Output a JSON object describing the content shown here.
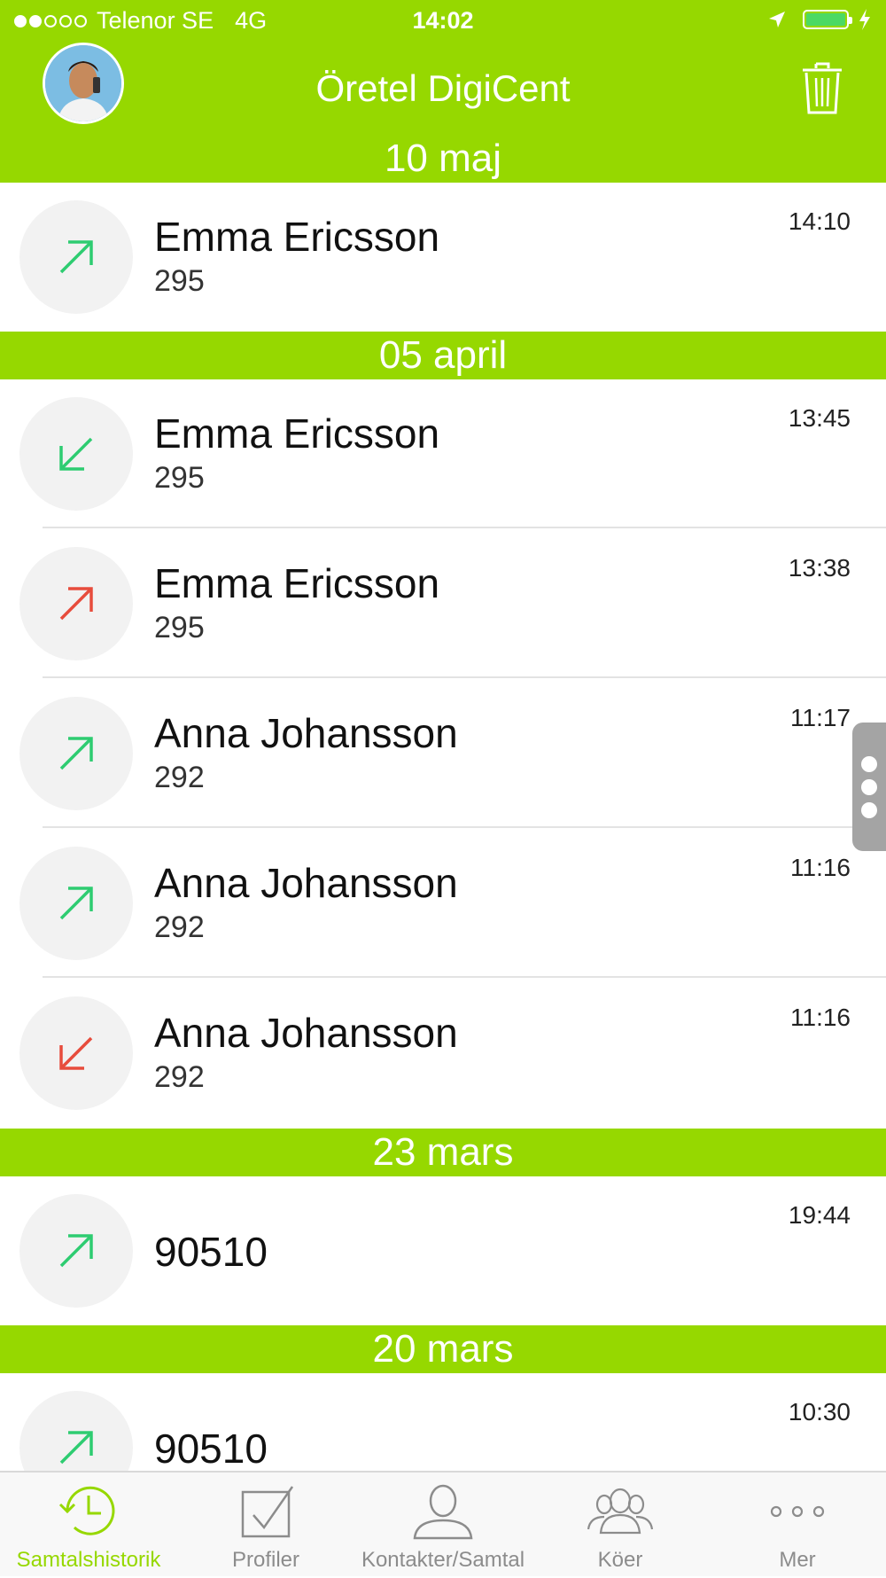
{
  "status_bar": {
    "carrier": "Telenor SE",
    "network": "4G",
    "time": "14:02"
  },
  "header": {
    "title": "Öretel DigiCent"
  },
  "colors": {
    "brand_green": "#96d800",
    "call_green": "#2ecc71",
    "call_red": "#e74c3c"
  },
  "sections": [
    {
      "date": "10 maj",
      "calls": [
        {
          "name": "Emma Ericsson",
          "ext": "295",
          "time": "14:10",
          "direction": "outgoing",
          "status": "answered",
          "icon": "arrow-up-right-icon"
        }
      ]
    },
    {
      "date": "05 april",
      "calls": [
        {
          "name": "Emma Ericsson",
          "ext": "295",
          "time": "13:45",
          "direction": "incoming",
          "status": "answered",
          "icon": "arrow-down-left-icon"
        },
        {
          "name": "Emma Ericsson",
          "ext": "295",
          "time": "13:38",
          "direction": "outgoing",
          "status": "missed",
          "icon": "arrow-up-right-icon"
        },
        {
          "name": "Anna Johansson",
          "ext": "292",
          "time": "11:17",
          "direction": "outgoing",
          "status": "answered",
          "icon": "arrow-up-right-icon"
        },
        {
          "name": "Anna Johansson",
          "ext": "292",
          "time": "11:16",
          "direction": "outgoing",
          "status": "answered",
          "icon": "arrow-up-right-icon"
        },
        {
          "name": "Anna Johansson",
          "ext": "292",
          "time": "11:16",
          "direction": "incoming",
          "status": "missed",
          "icon": "arrow-down-left-icon"
        }
      ]
    },
    {
      "date": "23 mars",
      "calls": [
        {
          "name": "90510",
          "ext": "",
          "time": "19:44",
          "direction": "outgoing",
          "status": "answered",
          "icon": "arrow-up-right-icon"
        }
      ]
    },
    {
      "date": "20 mars",
      "calls": [
        {
          "name": "90510",
          "ext": "",
          "time": "10:30",
          "direction": "outgoing",
          "status": "answered",
          "icon": "arrow-up-right-icon"
        }
      ]
    }
  ],
  "tabbar": {
    "tabs": [
      {
        "label": "Samtalshistorik",
        "icon": "history-clock-icon",
        "active": true
      },
      {
        "label": "Profiler",
        "icon": "checkbox-icon",
        "active": false
      },
      {
        "label": "Kontakter/Samtal",
        "icon": "person-icon",
        "active": false
      },
      {
        "label": "Köer",
        "icon": "group-icon",
        "active": false
      },
      {
        "label": "Mer",
        "icon": "more-dots-icon",
        "active": false
      }
    ]
  }
}
